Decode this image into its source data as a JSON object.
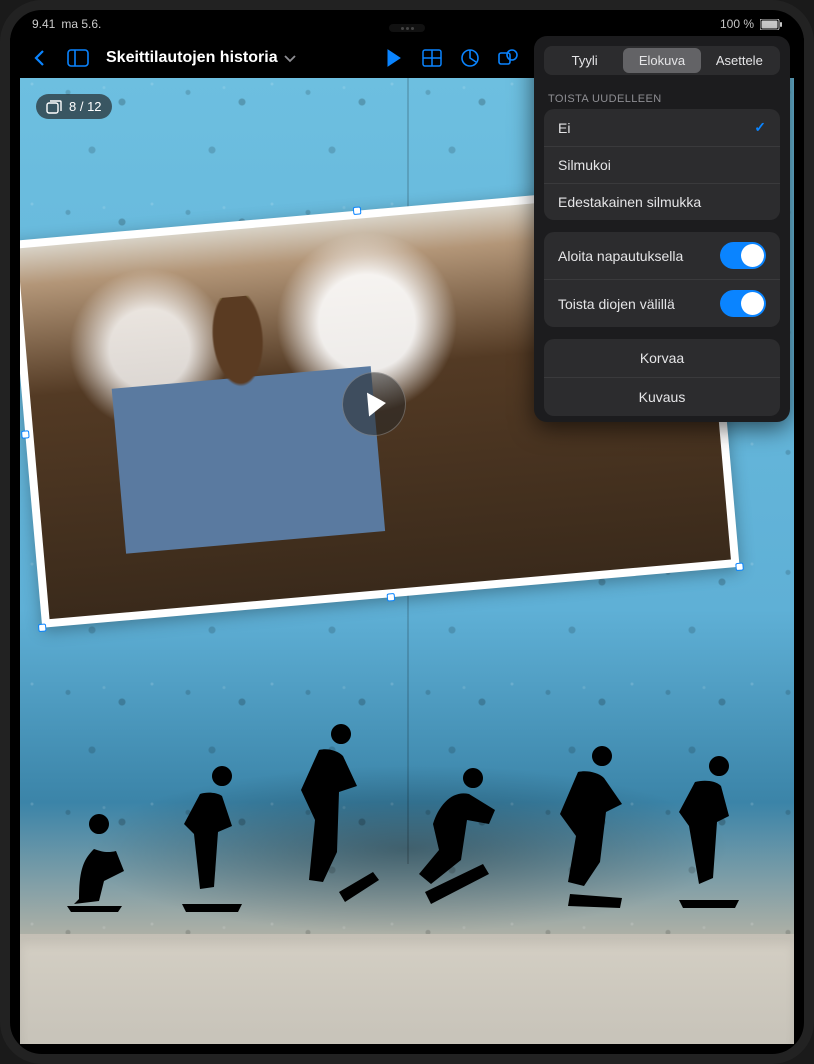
{
  "status": {
    "time": "9.41",
    "date": "ma 5.6.",
    "battery": "100 %",
    "battery_icon": "■"
  },
  "toolbar": {
    "title": "Skeittilautojen historia"
  },
  "slide_counter": {
    "current": 8,
    "total": 12
  },
  "popover": {
    "tabs": {
      "style": "Tyyli",
      "movie": "Elokuva",
      "arrange": "Asettele"
    },
    "active_tab": "Elokuva",
    "repeat_section": "TOISTA UUDELLEEN",
    "repeat_options": {
      "none": "Ei",
      "loop": "Silmukoi",
      "bounce": "Edestakainen silmukka",
      "selected": "none"
    },
    "toggles": {
      "start_tap": {
        "label": "Aloita napautuksella",
        "value": true
      },
      "play_across": {
        "label": "Toista diojen välillä",
        "value": true
      }
    },
    "actions": {
      "replace": "Korvaa",
      "description": "Kuvaus"
    }
  }
}
